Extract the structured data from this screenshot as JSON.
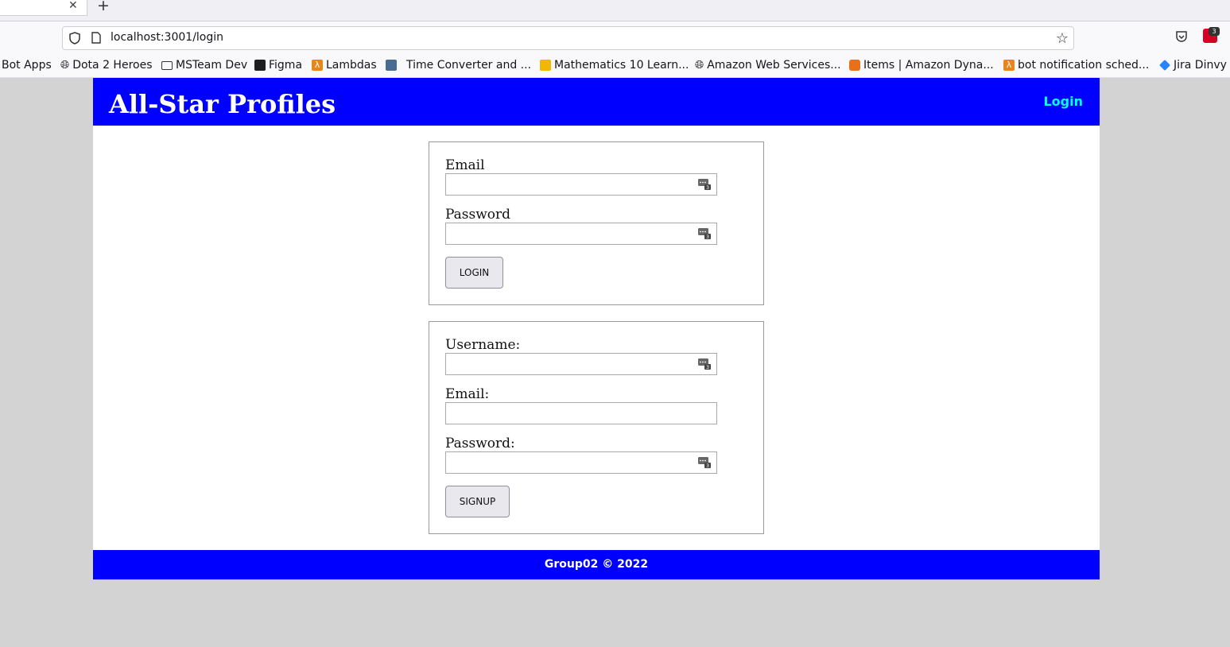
{
  "browser": {
    "url": "localhost:3001/login",
    "bookmarks": [
      {
        "label": "Bot Apps",
        "icon": "none"
      },
      {
        "label": "Dota 2 Heroes",
        "icon": "globe-icon"
      },
      {
        "label": "MSTeam Dev",
        "icon": "folder-icon"
      },
      {
        "label": "Figma",
        "icon": "figma-icon"
      },
      {
        "label": "Lambdas",
        "icon": "aws-lambda-icon"
      },
      {
        "label": "Time Converter and ...",
        "icon": "clock-icon"
      },
      {
        "label": "Mathematics 10 Learn...",
        "icon": "book-icon"
      },
      {
        "label": "Amazon Web Services...",
        "icon": "globe-icon"
      },
      {
        "label": "Items | Amazon Dyna...",
        "icon": "dynamodb-icon"
      },
      {
        "label": "bot notification sched...",
        "icon": "aws-lambda-icon"
      },
      {
        "label": "Jira Dinvy",
        "icon": "jira-icon"
      }
    ],
    "extension_badge": "3"
  },
  "header": {
    "title": "All-Star Profiles",
    "nav_login": "Login"
  },
  "login_form": {
    "email_label": "Email",
    "email_value": "",
    "password_label": "Password",
    "password_value": "",
    "submit_label": "LOGIN"
  },
  "signup_form": {
    "username_label": "Username:",
    "username_value": "",
    "email_label": "Email:",
    "email_value": "",
    "password_label": "Password:",
    "password_value": "",
    "submit_label": "SIGNUP"
  },
  "footer": {
    "text": "Group02 © 2022"
  },
  "colors": {
    "brand_blue": "#0000ff",
    "nav_link": "#00ffff",
    "page_bg": "#d3d3d3"
  }
}
